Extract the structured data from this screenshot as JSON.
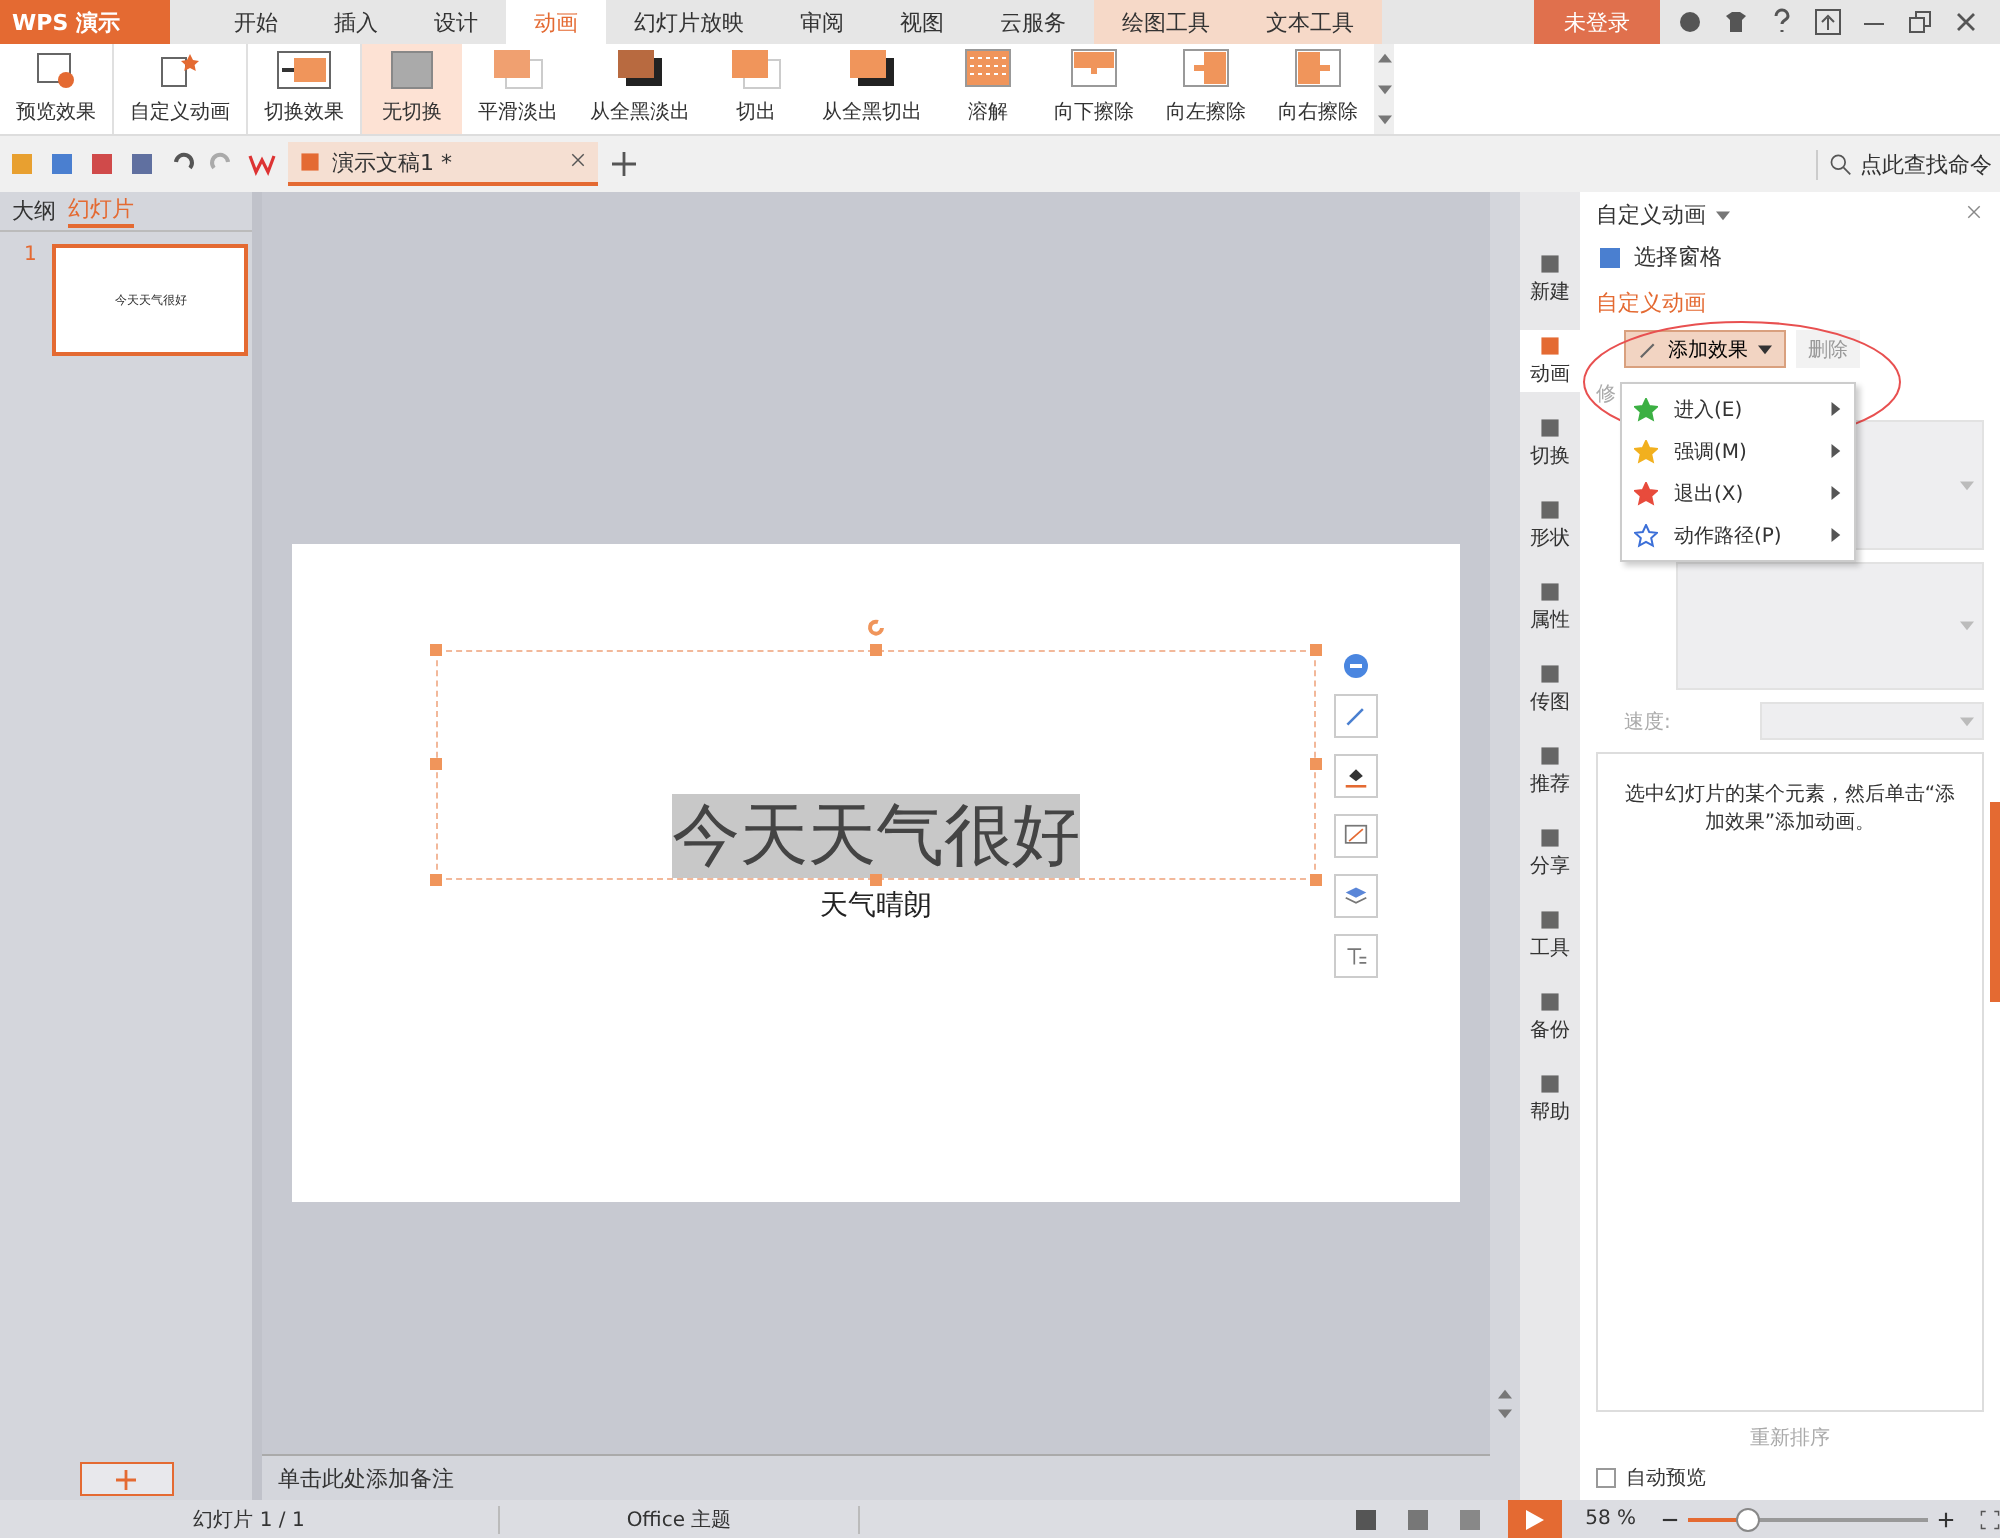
{
  "app_button": "WPS 演示",
  "tabs": [
    {
      "label": "开始",
      "selected": false,
      "kind": "main"
    },
    {
      "label": "插入",
      "selected": false,
      "kind": "main"
    },
    {
      "label": "设计",
      "selected": false,
      "kind": "main"
    },
    {
      "label": "动画",
      "selected": true,
      "kind": "main"
    },
    {
      "label": "幻灯片放映",
      "selected": false,
      "kind": "main"
    },
    {
      "label": "审阅",
      "selected": false,
      "kind": "main"
    },
    {
      "label": "视图",
      "selected": false,
      "kind": "main"
    },
    {
      "label": "云服务",
      "selected": false,
      "kind": "main"
    },
    {
      "label": "绘图工具",
      "selected": false,
      "kind": "context"
    },
    {
      "label": "文本工具",
      "selected": false,
      "kind": "context"
    }
  ],
  "login_button": "未登录",
  "ribbon": [
    {
      "label": "预览效果",
      "kind": "preview",
      "selected": false
    },
    {
      "label": "自定义动画",
      "kind": "custom",
      "selected": false
    },
    {
      "label": "切换效果",
      "kind": "switch",
      "selected": false
    },
    {
      "label": "无切换",
      "kind": "none",
      "selected": true
    },
    {
      "label": "平滑淡出",
      "kind": "fade",
      "selected": false
    },
    {
      "label": "从全黑淡出",
      "kind": "blackfade",
      "selected": false
    },
    {
      "label": "切出",
      "kind": "cut",
      "selected": false
    },
    {
      "label": "从全黑切出",
      "kind": "blackcut",
      "selected": false
    },
    {
      "label": "溶解",
      "kind": "dissolve",
      "selected": false
    },
    {
      "label": "向下擦除",
      "kind": "down",
      "selected": false
    },
    {
      "label": "向左擦除",
      "kind": "left",
      "selected": false
    },
    {
      "label": "向右擦除",
      "kind": "right",
      "selected": false
    }
  ],
  "document_tab": {
    "title": "演示文稿1 *"
  },
  "search_command": "点此查找命令",
  "left_panel": {
    "tabs": [
      {
        "label": "大纲",
        "selected": false
      },
      {
        "label": "幻灯片",
        "selected": true
      }
    ],
    "slides": [
      {
        "number": "1",
        "title": "今天天气很好",
        "selected": true
      }
    ]
  },
  "slide": {
    "title": "今天天气很好",
    "subtitle": "天气晴朗"
  },
  "notes_placeholder": "单击此处添加备注",
  "side_bar": [
    {
      "label": "新建",
      "selected": false
    },
    {
      "label": "动画",
      "selected": true
    },
    {
      "label": "切换",
      "selected": false
    },
    {
      "label": "形状",
      "selected": false
    },
    {
      "label": "属性",
      "selected": false
    },
    {
      "label": "传图",
      "selected": false
    },
    {
      "label": "推荐",
      "selected": false
    },
    {
      "label": "分享",
      "selected": false
    },
    {
      "label": "工具",
      "selected": false
    },
    {
      "label": "备份",
      "selected": false
    },
    {
      "label": "帮助",
      "selected": false
    }
  ],
  "task_pane": {
    "title": "自定义动画",
    "select_pane": "选择窗格",
    "section": "自定义动画",
    "add_effect": "添加效果",
    "delete": {
      "label": "删除",
      "disabled": true
    },
    "modify_label": "修",
    "speed_label": "速度:",
    "hint": "选中幻灯片的某个元素，然后单击“添加效果”添加动画。",
    "reorder": "重新排序",
    "auto_preview": "自动预览",
    "auto_preview_checked": false,
    "menu": [
      {
        "label": "进入(E)",
        "color": "#3cb043"
      },
      {
        "label": "强调(M)",
        "color": "#f2b01e"
      },
      {
        "label": "退出(X)",
        "color": "#e84b3c"
      },
      {
        "label": "动作路径(P)",
        "color": "#3b6fd8"
      }
    ]
  },
  "status_bar": {
    "slide": "幻灯片 1 / 1",
    "theme": "Office 主题",
    "zoom": "58 %",
    "level": 0.25
  }
}
